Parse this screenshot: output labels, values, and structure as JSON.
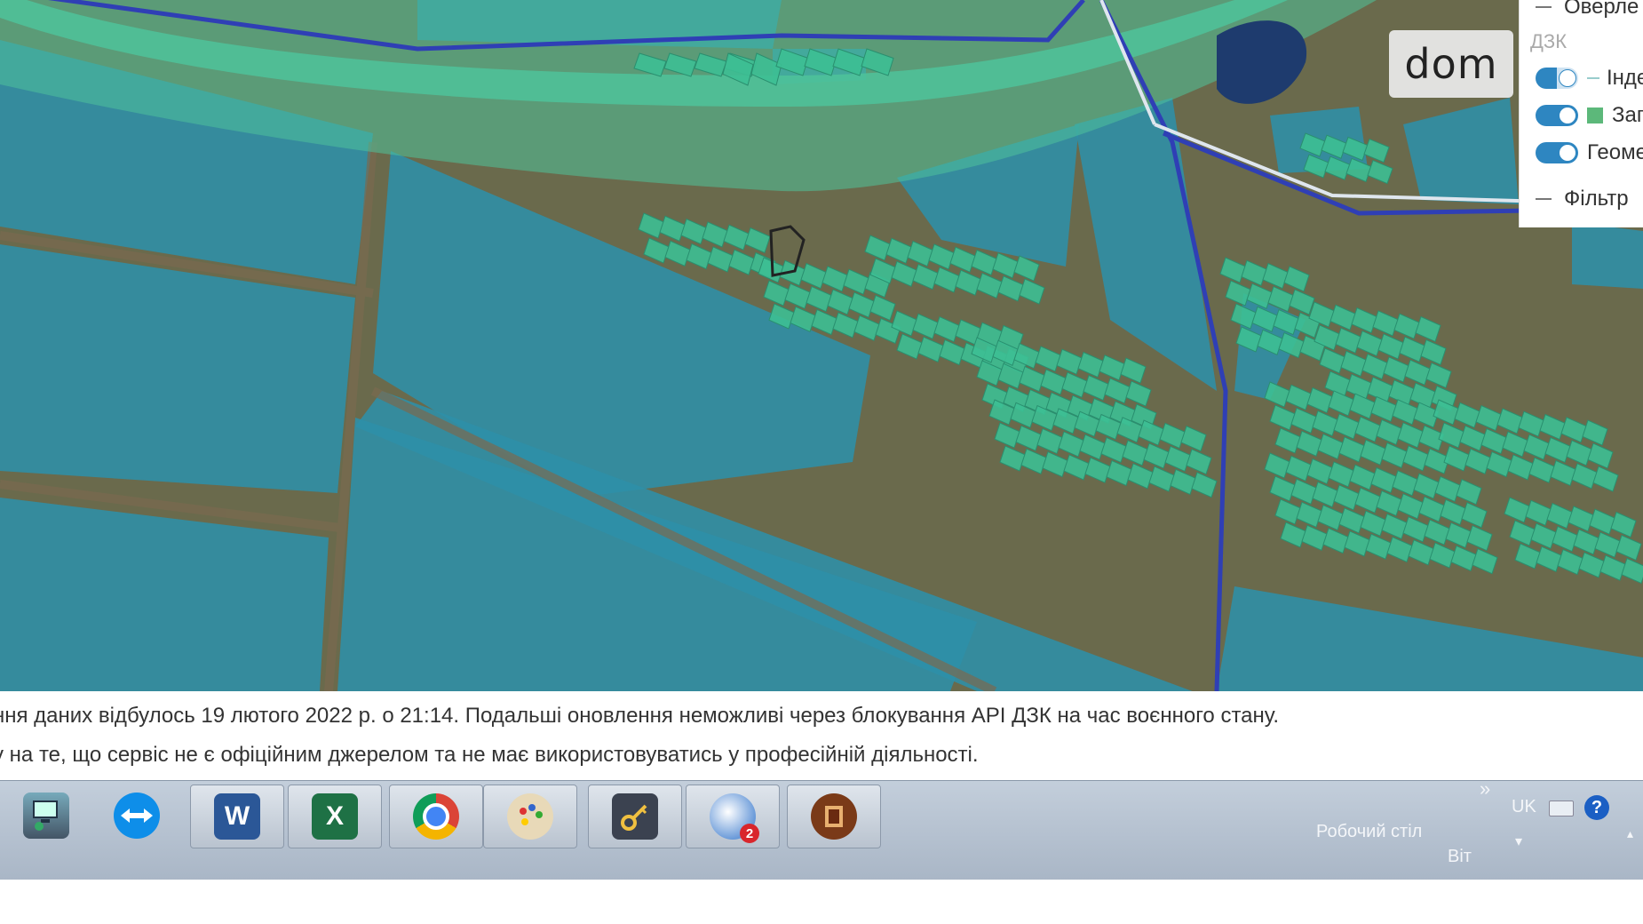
{
  "watermark": {
    "text": "dom"
  },
  "layer_panel": {
    "items": [
      {
        "label": "Оверле",
        "type": "group"
      },
      {
        "label": "Індє",
        "type": "toggle-partial"
      },
      {
        "label": "Зап",
        "type": "toggle"
      },
      {
        "label": "Геоме",
        "type": "toggle"
      },
      {
        "label": "Фільтр",
        "type": "dash"
      }
    ],
    "section_label": "ДЗК",
    "swatch_color": "#5cb87a"
  },
  "notice": {
    "line1": "ння даних відбулось 19 лютого 2022 р. о 21:14. Подальші оновлення неможливі через блокування API ДЗК на час воєнного стану.",
    "line2": "у на те, що сервіс не є офіційним джерелом та не має використовуватись у професійній діяльності."
  },
  "taskbar": {
    "apps": [
      {
        "name": "network-app",
        "label": ""
      },
      {
        "name": "teamviewer",
        "label": ""
      },
      {
        "name": "word",
        "label": "W"
      },
      {
        "name": "excel",
        "label": "X"
      },
      {
        "name": "chrome",
        "label": ""
      },
      {
        "name": "paint",
        "label": ""
      },
      {
        "name": "key-app",
        "label": ""
      },
      {
        "name": "thunderbird",
        "label": "",
        "badge": "2"
      },
      {
        "name": "archive-app",
        "label": ""
      }
    ],
    "desktop_label": "Робочий стіл",
    "language": "UK",
    "expand_symbol": "»",
    "help_symbol": "?",
    "day_label": "Віт"
  },
  "colors": {
    "parcel_blue": "#2e8fa8",
    "parcel_green": "#3dbf94",
    "boundary_blue": "#2f3fb5",
    "corridor_green": "#4fc39a"
  }
}
